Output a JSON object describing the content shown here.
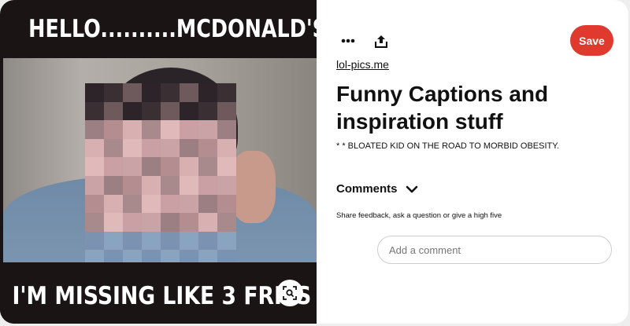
{
  "meme": {
    "top_text": "HELLO..........MCDONALD'S?",
    "bottom_text": "I'M MISSING LIKE 3 FRIES"
  },
  "icons": {
    "more": "ellipsis-icon",
    "share": "share-upload-icon",
    "lens": "visual-search-icon",
    "chevron": "chevron-down-icon"
  },
  "toolbar": {
    "save_label": "Save"
  },
  "pin": {
    "source": "lol-pics.me",
    "title": "Funny Captions and inspiration stuff",
    "description": "* * BLOATED KID ON THE ROAD TO MORBID OBESITY."
  },
  "comments": {
    "heading": "Comments",
    "subtitle": "Share feedback, ask a question or give a high five",
    "placeholder": "Add a comment"
  },
  "colors": {
    "save_button": "#e03a2f",
    "meme_background": "#1a1414",
    "text": "#111111"
  }
}
